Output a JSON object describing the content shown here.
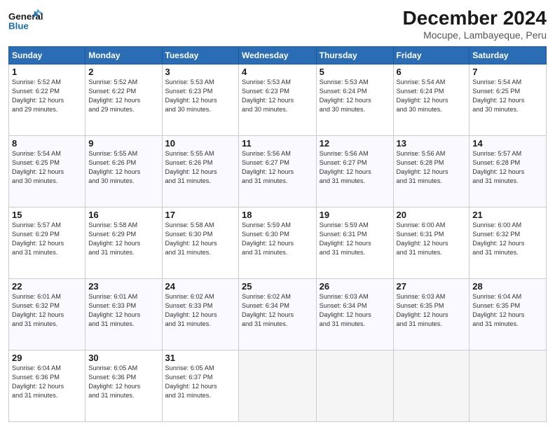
{
  "header": {
    "logo_line1": "General",
    "logo_line2": "Blue",
    "title": "December 2024",
    "subtitle": "Mocupe, Lambayeque, Peru"
  },
  "weekdays": [
    "Sunday",
    "Monday",
    "Tuesday",
    "Wednesday",
    "Thursday",
    "Friday",
    "Saturday"
  ],
  "weeks": [
    [
      {
        "day": "1",
        "info": "Sunrise: 5:52 AM\nSunset: 6:22 PM\nDaylight: 12 hours\nand 29 minutes."
      },
      {
        "day": "2",
        "info": "Sunrise: 5:52 AM\nSunset: 6:22 PM\nDaylight: 12 hours\nand 29 minutes."
      },
      {
        "day": "3",
        "info": "Sunrise: 5:53 AM\nSunset: 6:23 PM\nDaylight: 12 hours\nand 30 minutes."
      },
      {
        "day": "4",
        "info": "Sunrise: 5:53 AM\nSunset: 6:23 PM\nDaylight: 12 hours\nand 30 minutes."
      },
      {
        "day": "5",
        "info": "Sunrise: 5:53 AM\nSunset: 6:24 PM\nDaylight: 12 hours\nand 30 minutes."
      },
      {
        "day": "6",
        "info": "Sunrise: 5:54 AM\nSunset: 6:24 PM\nDaylight: 12 hours\nand 30 minutes."
      },
      {
        "day": "7",
        "info": "Sunrise: 5:54 AM\nSunset: 6:25 PM\nDaylight: 12 hours\nand 30 minutes."
      }
    ],
    [
      {
        "day": "8",
        "info": "Sunrise: 5:54 AM\nSunset: 6:25 PM\nDaylight: 12 hours\nand 30 minutes."
      },
      {
        "day": "9",
        "info": "Sunrise: 5:55 AM\nSunset: 6:26 PM\nDaylight: 12 hours\nand 30 minutes."
      },
      {
        "day": "10",
        "info": "Sunrise: 5:55 AM\nSunset: 6:26 PM\nDaylight: 12 hours\nand 31 minutes."
      },
      {
        "day": "11",
        "info": "Sunrise: 5:56 AM\nSunset: 6:27 PM\nDaylight: 12 hours\nand 31 minutes."
      },
      {
        "day": "12",
        "info": "Sunrise: 5:56 AM\nSunset: 6:27 PM\nDaylight: 12 hours\nand 31 minutes."
      },
      {
        "day": "13",
        "info": "Sunrise: 5:56 AM\nSunset: 6:28 PM\nDaylight: 12 hours\nand 31 minutes."
      },
      {
        "day": "14",
        "info": "Sunrise: 5:57 AM\nSunset: 6:28 PM\nDaylight: 12 hours\nand 31 minutes."
      }
    ],
    [
      {
        "day": "15",
        "info": "Sunrise: 5:57 AM\nSunset: 6:29 PM\nDaylight: 12 hours\nand 31 minutes."
      },
      {
        "day": "16",
        "info": "Sunrise: 5:58 AM\nSunset: 6:29 PM\nDaylight: 12 hours\nand 31 minutes."
      },
      {
        "day": "17",
        "info": "Sunrise: 5:58 AM\nSunset: 6:30 PM\nDaylight: 12 hours\nand 31 minutes."
      },
      {
        "day": "18",
        "info": "Sunrise: 5:59 AM\nSunset: 6:30 PM\nDaylight: 12 hours\nand 31 minutes."
      },
      {
        "day": "19",
        "info": "Sunrise: 5:59 AM\nSunset: 6:31 PM\nDaylight: 12 hours\nand 31 minutes."
      },
      {
        "day": "20",
        "info": "Sunrise: 6:00 AM\nSunset: 6:31 PM\nDaylight: 12 hours\nand 31 minutes."
      },
      {
        "day": "21",
        "info": "Sunrise: 6:00 AM\nSunset: 6:32 PM\nDaylight: 12 hours\nand 31 minutes."
      }
    ],
    [
      {
        "day": "22",
        "info": "Sunrise: 6:01 AM\nSunset: 6:32 PM\nDaylight: 12 hours\nand 31 minutes."
      },
      {
        "day": "23",
        "info": "Sunrise: 6:01 AM\nSunset: 6:33 PM\nDaylight: 12 hours\nand 31 minutes."
      },
      {
        "day": "24",
        "info": "Sunrise: 6:02 AM\nSunset: 6:33 PM\nDaylight: 12 hours\nand 31 minutes."
      },
      {
        "day": "25",
        "info": "Sunrise: 6:02 AM\nSunset: 6:34 PM\nDaylight: 12 hours\nand 31 minutes."
      },
      {
        "day": "26",
        "info": "Sunrise: 6:03 AM\nSunset: 6:34 PM\nDaylight: 12 hours\nand 31 minutes."
      },
      {
        "day": "27",
        "info": "Sunrise: 6:03 AM\nSunset: 6:35 PM\nDaylight: 12 hours\nand 31 minutes."
      },
      {
        "day": "28",
        "info": "Sunrise: 6:04 AM\nSunset: 6:35 PM\nDaylight: 12 hours\nand 31 minutes."
      }
    ],
    [
      {
        "day": "29",
        "info": "Sunrise: 6:04 AM\nSunset: 6:36 PM\nDaylight: 12 hours\nand 31 minutes."
      },
      {
        "day": "30",
        "info": "Sunrise: 6:05 AM\nSunset: 6:36 PM\nDaylight: 12 hours\nand 31 minutes."
      },
      {
        "day": "31",
        "info": "Sunrise: 6:05 AM\nSunset: 6:37 PM\nDaylight: 12 hours\nand 31 minutes."
      },
      null,
      null,
      null,
      null
    ]
  ]
}
